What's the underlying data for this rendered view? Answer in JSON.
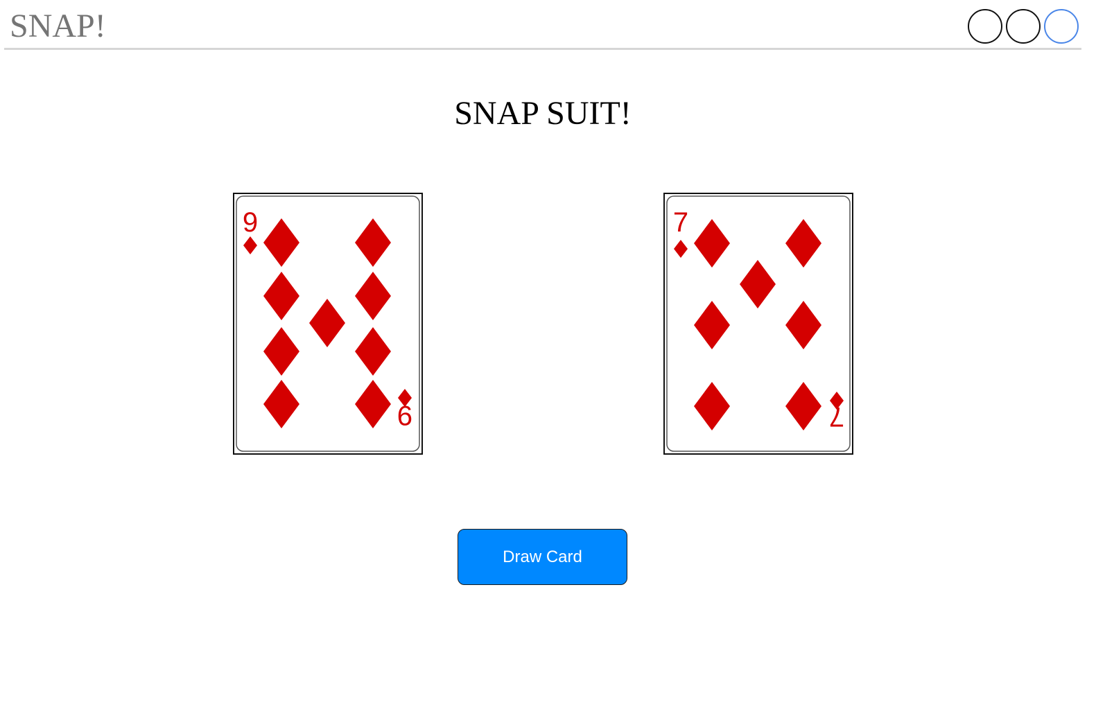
{
  "header": {
    "logo": "SNAP!",
    "indicators": [
      {
        "state": "empty"
      },
      {
        "state": "empty"
      },
      {
        "state": "active",
        "color": "#4a86e8"
      }
    ]
  },
  "game": {
    "title": "SNAP SUIT!",
    "cards": [
      {
        "rank": "9",
        "suit": "diamonds",
        "suit_symbol": "♦",
        "color": "#d40000"
      },
      {
        "rank": "7",
        "suit": "diamonds",
        "suit_symbol": "♦",
        "color": "#d40000"
      }
    ],
    "draw_button_label": "Draw Card",
    "draw_button_color": "#0088ff"
  }
}
